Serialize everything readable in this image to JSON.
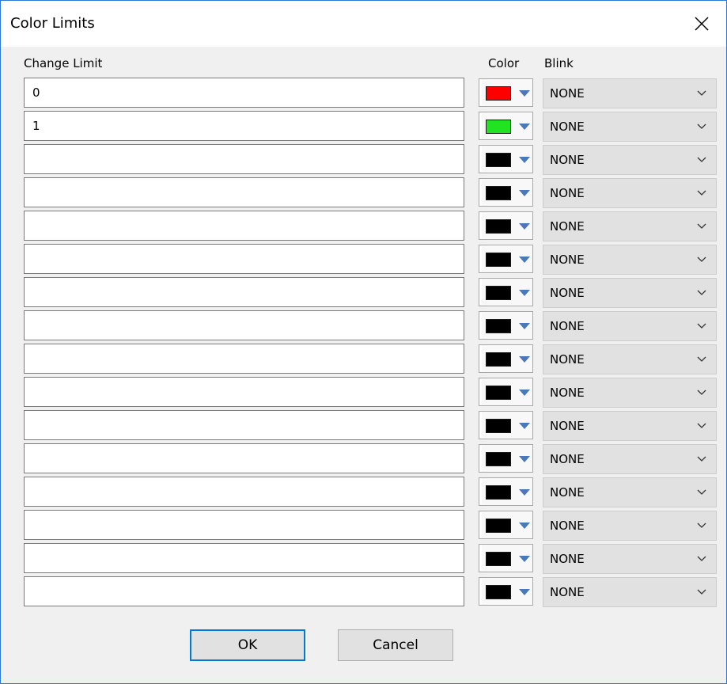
{
  "window": {
    "title": "Color Limits",
    "close_icon": "close-icon"
  },
  "headers": {
    "change_limit": "Change Limit",
    "color": "Color",
    "blink": "Blink"
  },
  "rows": [
    {
      "limit": "0",
      "color": "#ff0000",
      "blink": "NONE"
    },
    {
      "limit": "1",
      "color": "#22e322",
      "blink": "NONE"
    },
    {
      "limit": "",
      "color": "#000000",
      "blink": "NONE"
    },
    {
      "limit": "",
      "color": "#000000",
      "blink": "NONE"
    },
    {
      "limit": "",
      "color": "#000000",
      "blink": "NONE"
    },
    {
      "limit": "",
      "color": "#000000",
      "blink": "NONE"
    },
    {
      "limit": "",
      "color": "#000000",
      "blink": "NONE"
    },
    {
      "limit": "",
      "color": "#000000",
      "blink": "NONE"
    },
    {
      "limit": "",
      "color": "#000000",
      "blink": "NONE"
    },
    {
      "limit": "",
      "color": "#000000",
      "blink": "NONE"
    },
    {
      "limit": "",
      "color": "#000000",
      "blink": "NONE"
    },
    {
      "limit": "",
      "color": "#000000",
      "blink": "NONE"
    },
    {
      "limit": "",
      "color": "#000000",
      "blink": "NONE"
    },
    {
      "limit": "",
      "color": "#000000",
      "blink": "NONE"
    },
    {
      "limit": "",
      "color": "#000000",
      "blink": "NONE"
    },
    {
      "limit": "",
      "color": "#000000",
      "blink": "NONE"
    }
  ],
  "buttons": {
    "ok": "OK",
    "cancel": "Cancel"
  },
  "colors": {
    "focus_accent": "#0078d7",
    "dropdown_arrow": "#4a78b8"
  }
}
